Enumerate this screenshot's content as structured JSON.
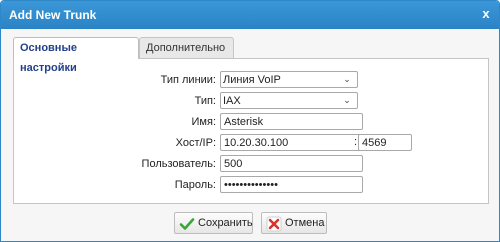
{
  "dialog": {
    "title": "Add New Trunk",
    "close_label": "x"
  },
  "tabs": [
    {
      "label": "Основные настройки",
      "active": true
    },
    {
      "label": "Дополнительно",
      "active": false
    }
  ],
  "form": {
    "line_type": {
      "label": "Тип линии:",
      "value": "Линия VoIP",
      "options": [
        "Линия VoIP"
      ]
    },
    "type": {
      "label": "Тип:",
      "value": "IAX",
      "options": [
        "IAX"
      ]
    },
    "name": {
      "label": "Имя:",
      "value": "Asterisk"
    },
    "host": {
      "label": "Хост/IP:",
      "value": "10.20.30.100",
      "separator": ":",
      "port": "4569"
    },
    "user": {
      "label": "Пользователь:",
      "value": "500"
    },
    "password": {
      "label": "Пароль:",
      "value": "secretpass1234"
    }
  },
  "buttons": {
    "save": {
      "label": "Сохранить",
      "icon": "checkmark-icon",
      "color": "#3aa635"
    },
    "cancel": {
      "label": "Отмена",
      "icon": "x-icon",
      "color": "#d9342b"
    }
  },
  "colors": {
    "titlebar": "#2f8ccf",
    "active_tab_text": "#23408a"
  }
}
